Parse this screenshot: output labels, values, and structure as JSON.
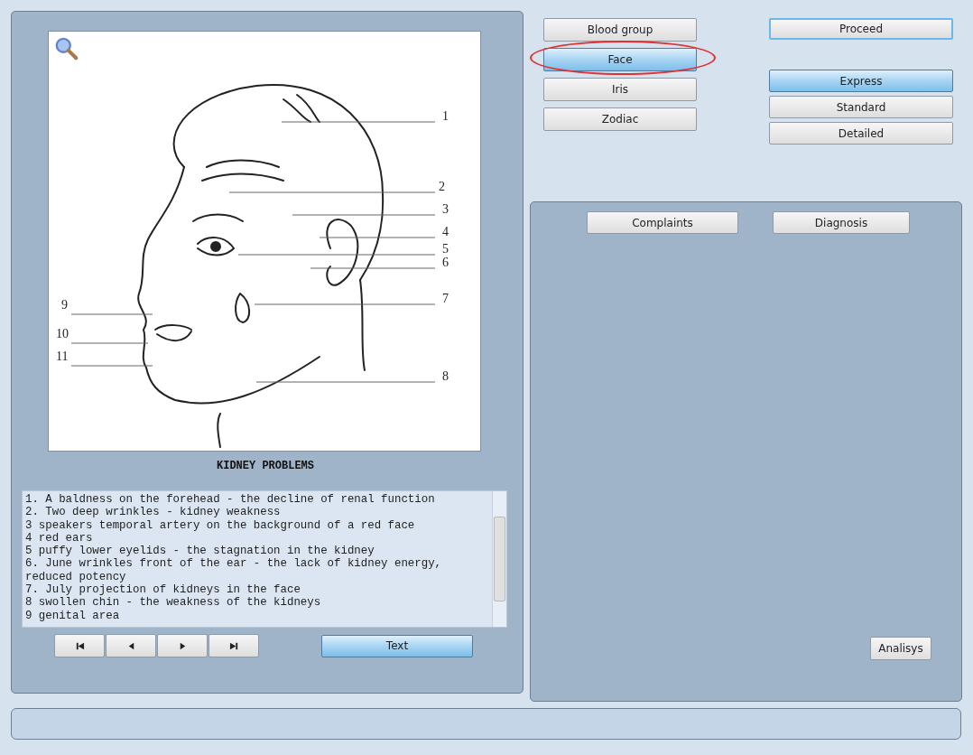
{
  "image_panel": {
    "right_callouts": [
      "1",
      "2",
      "3",
      "4",
      "5",
      "6",
      "7",
      "8"
    ],
    "left_callouts": [
      "9",
      "10",
      "11"
    ],
    "caption": "KIDNEY PROBLEMS"
  },
  "description": {
    "lines": [
      "1. A baldness on the forehead - the decline of renal function",
      "2. Two deep wrinkles - kidney weakness",
      "3 speakers temporal artery on the background of a red face",
      "4 red ears",
      "5 puffy lower eyelids - the stagnation in the kidney",
      "6. June wrinkles front of the ear - the lack of kidney energy, reduced potency",
      "7. July projection of kidneys in the face",
      "8 swollen chin - the weakness of the kidneys",
      "9 genital area"
    ]
  },
  "navigation": [
    {
      "kind": "first"
    },
    {
      "kind": "prev"
    },
    {
      "kind": "next"
    },
    {
      "kind": "last"
    }
  ],
  "text_button": {
    "label": "Text",
    "selected": true
  },
  "methods": [
    {
      "label": "Blood group",
      "selected": false,
      "circled": false
    },
    {
      "label": "Face",
      "selected": true,
      "circled": true
    },
    {
      "label": "Iris",
      "selected": false,
      "circled": false
    },
    {
      "label": "Zodiac",
      "selected": false,
      "circled": false
    }
  ],
  "proceed_button": {
    "label": "Proceed",
    "focused": true
  },
  "modes": [
    {
      "label": "Express",
      "selected": true
    },
    {
      "label": "Standard",
      "selected": false
    },
    {
      "label": "Detailed",
      "selected": false
    }
  ],
  "results_panel": {
    "tabs": [
      {
        "label": "Complaints"
      },
      {
        "label": "Diagnosis"
      }
    ],
    "analysis_button": {
      "label": "Analisys"
    }
  }
}
